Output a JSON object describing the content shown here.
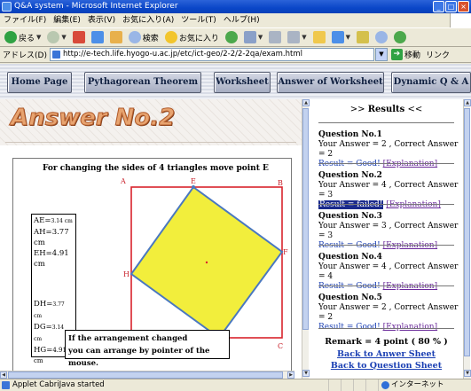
{
  "window": {
    "title": "Q&A system - Microsoft Internet Explorer"
  },
  "menu": [
    "ファイル(F)",
    "編集(E)",
    "表示(V)",
    "お気に入り(A)",
    "ツール(T)",
    "ヘルプ(H)"
  ],
  "toolbar": {
    "back": "戻る",
    "search": "検索",
    "favorites": "お気に入り"
  },
  "address": {
    "label": "アドレス(D)",
    "url": "http://e-tech.life.hyogo-u.ac.jp/etc/ict-geo/2-2/2-2qa/exam.html",
    "go": "移動",
    "links": "リンク"
  },
  "nav": [
    "Home Page",
    "Pythagorean Theorem",
    "Worksheet",
    "Answer of Worksheet",
    "Dynamic Q & A"
  ],
  "banner": {
    "title": "Answer No.2"
  },
  "applet": {
    "instruction": "For changing the sides of 4 triangles move point E",
    "vertices": {
      "A": "A",
      "B": "B",
      "C": "C",
      "D": "D",
      "E": "E",
      "F": "F",
      "G": "G",
      "H": "H"
    },
    "values_top": [
      {
        "name": "AE=",
        "value": "3.14 cm"
      },
      {
        "name": "AH=",
        "value": "3.77 cm"
      },
      {
        "name": "EH=",
        "value": "4.91 cm"
      }
    ],
    "values_bottom": [
      {
        "name": "DH=",
        "value": "3.77 cm"
      },
      {
        "name": "DG=",
        "value": "3.14 cm"
      },
      {
        "name": "HG=",
        "value": "4.91 cm"
      }
    ],
    "note": [
      "If the arrangement changed",
      "you can arrange by pointer of the mouse."
    ],
    "colors": {
      "square_frame": "#d9232c",
      "inner_fill": "#f2ee3c",
      "inner_stroke": "#4a78c0"
    }
  },
  "results": {
    "title_prefix": ">> ",
    "title": "Results",
    "title_suffix": " <<",
    "questions": [
      {
        "title": "Question No.1",
        "answer": "Your Answer = 2 , Correct Answer = 2",
        "result": "Result = Good!",
        "failed": false,
        "explanation": "[Explanation]"
      },
      {
        "title": "Question No.2",
        "answer": "Your Answer = 4 , Correct Answer = 3",
        "result": "Result = failed!",
        "failed": true,
        "explanation": "[Explanation]"
      },
      {
        "title": "Question No.3",
        "answer": "Your Answer = 3 , Correct Answer = 3",
        "result": "Result = Good!",
        "failed": false,
        "explanation": "[Explanation]"
      },
      {
        "title": "Question No.4",
        "answer": "Your Answer = 4 , Correct Answer = 4",
        "result": "Result = Good!",
        "failed": false,
        "explanation": "[Explanation]"
      },
      {
        "title": "Question No.5",
        "answer": "Your Answer = 2 , Correct Answer = 2",
        "result": "Result = Good!",
        "failed": false,
        "explanation": "[Explanation]"
      }
    ],
    "remark": "Remark = 4 point ( 80 % )",
    "back_answer": "Back to Anwer Sheet",
    "back_question": "Back to Question Sheet"
  },
  "status": {
    "text": "Applet CabriJava started",
    "zone": "インターネット"
  }
}
